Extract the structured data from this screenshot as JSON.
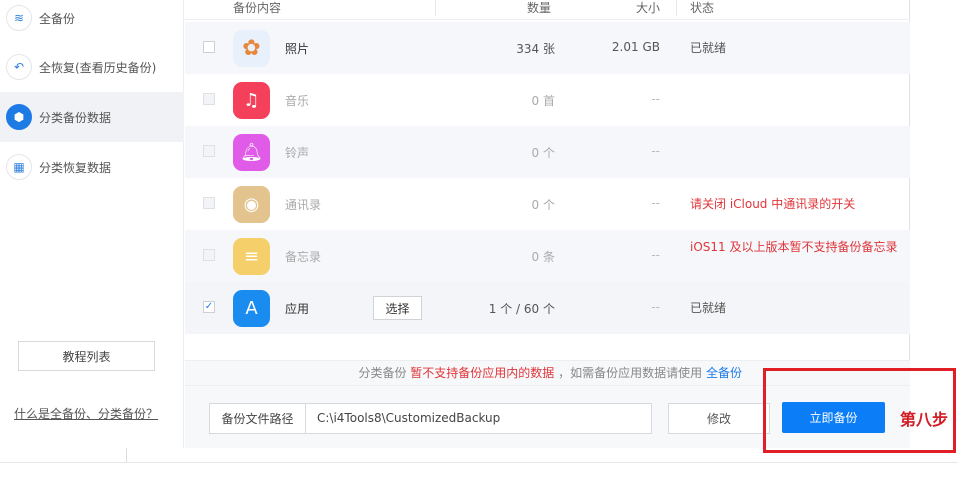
{
  "sidebar": {
    "items": [
      {
        "label": "全备份",
        "icon": "layers-icon"
      },
      {
        "label": "全恢复(查看历史备份)",
        "icon": "undo-icon"
      },
      {
        "label": "分类备份数据",
        "icon": "box-icon",
        "active": true
      },
      {
        "label": "分类恢复数据",
        "icon": "grid-icon"
      }
    ],
    "tutorial_button": "教程列表",
    "help_link": "什么是全备份、分类备份？"
  },
  "table": {
    "headers": {
      "content": "备份内容",
      "count": "数量",
      "size": "大小",
      "status": "状态"
    },
    "rows": [
      {
        "name": "照片",
        "count": "334 张",
        "size": "2.01 GB",
        "status": "已就绪",
        "checked": false,
        "enabled": true,
        "color": "#e8f0fb"
      },
      {
        "name": "音乐",
        "count": "0 首",
        "size": "--",
        "status": "",
        "checked": false,
        "enabled": false,
        "color": "#f4405a"
      },
      {
        "name": "铃声",
        "count": "0 个",
        "size": "--",
        "status": "",
        "checked": false,
        "enabled": false,
        "color": "#e05ce8"
      },
      {
        "name": "通讯录",
        "count": "0 个",
        "size": "--",
        "status": "请关闭 iCloud 中通讯录的开关",
        "checked": false,
        "enabled": false,
        "color": "#e3c48f"
      },
      {
        "name": "备忘录",
        "count": "0 条",
        "size": "--",
        "status": "iOS11 及以上版本暂不支持备份备忘录",
        "checked": false,
        "enabled": false,
        "color": "#f5cf6a"
      },
      {
        "name": "应用",
        "count": "1 个 / 60 个",
        "size": "--",
        "status": "已就绪",
        "checked": true,
        "enabled": true,
        "color": "#1a8cf0",
        "select_label": "选择"
      }
    ]
  },
  "note": {
    "prefix": "分类备份",
    "warning": "暂不支持备份应用内的数据",
    "middle": "，如需备份应用数据请使用",
    "link": "全备份"
  },
  "footer": {
    "path_label": "备份文件路径",
    "path_value": "C:\\i4Tools8\\CustomizedBackup",
    "modify_label": "修改",
    "backup_label": "立即备份"
  },
  "annotation": "第八步"
}
